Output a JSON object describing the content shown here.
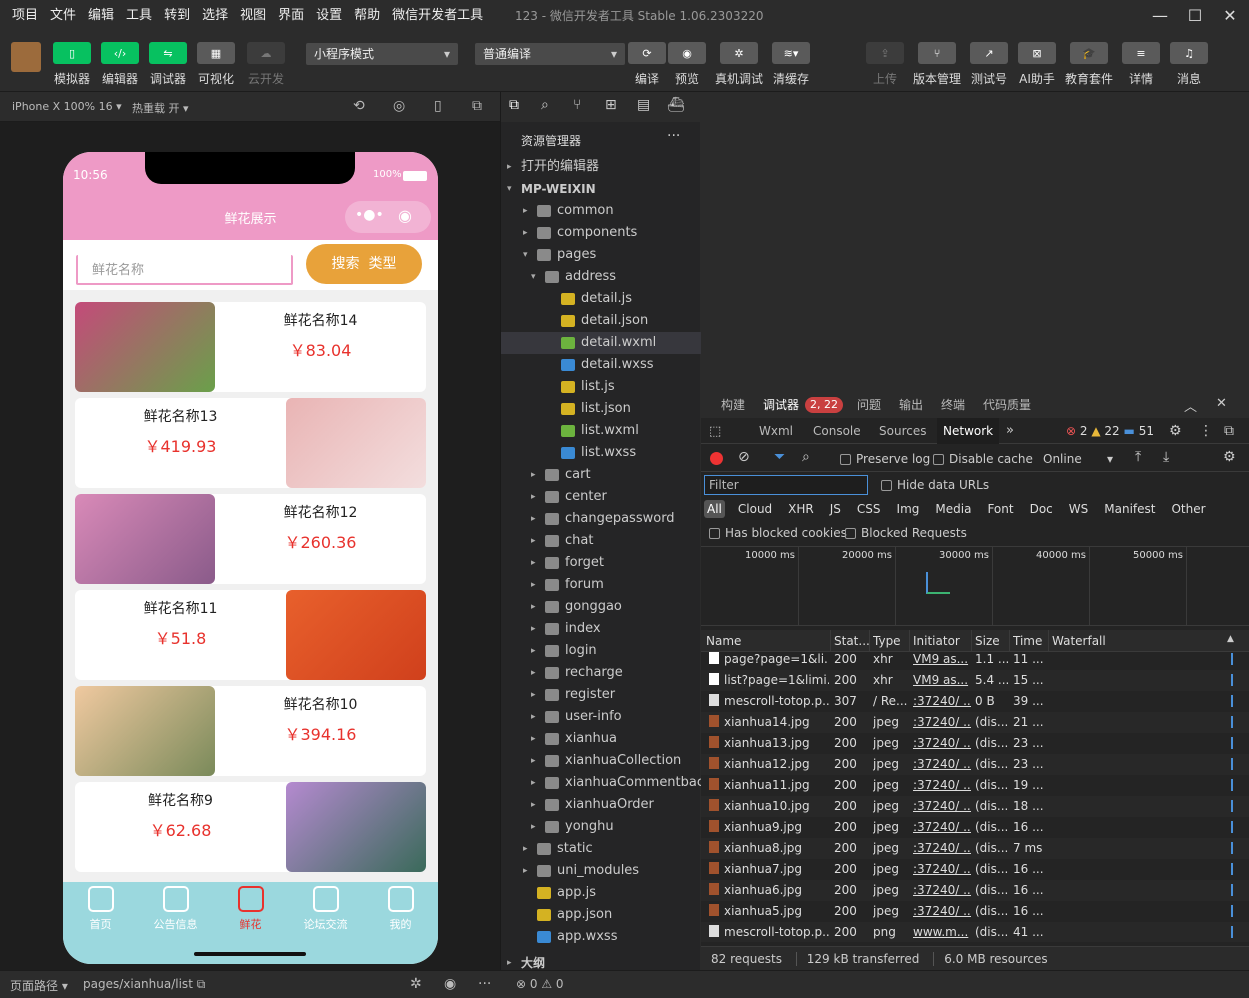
{
  "menubar": {
    "items": [
      "项目",
      "文件",
      "编辑",
      "工具",
      "转到",
      "选择",
      "视图",
      "界面",
      "设置",
      "帮助",
      "微信开发者工具"
    ],
    "title": "123 - 微信开发者工具 Stable 1.06.2303220"
  },
  "toolbar": {
    "left_buttons": [
      "模拟器",
      "编辑器",
      "调试器",
      "可视化",
      "云开发"
    ],
    "mode_select": "小程序模式",
    "compile_select": "普通编译",
    "mid_buttons": [
      "编译",
      "预览",
      "真机调试",
      "清缓存"
    ],
    "right_buttons": [
      "上传",
      "版本管理",
      "测试号",
      "AI助手",
      "教育套件",
      "详情",
      "消息"
    ]
  },
  "simbar": {
    "device": "iPhone X 100% 16",
    "hotreload": "热重载 开"
  },
  "phone": {
    "time": "10:56",
    "battery": "100%",
    "nav_title": "鲜花展示",
    "search_placeholder": "鲜花名称",
    "search_btn": "搜索",
    "type_btn": "类型",
    "cards": [
      {
        "name": "鲜花名称14",
        "price": "￥83.04"
      },
      {
        "name": "鲜花名称13",
        "price": "￥419.93"
      },
      {
        "name": "鲜花名称12",
        "price": "￥260.36"
      },
      {
        "name": "鲜花名称11",
        "price": "￥51.8"
      },
      {
        "name": "鲜花名称10",
        "price": "￥394.16"
      },
      {
        "name": "鲜花名称9",
        "price": "￥62.68"
      }
    ],
    "tabs": [
      "首页",
      "公告信息",
      "鲜花",
      "论坛交流",
      "我的"
    ]
  },
  "explorer": {
    "title": "资源管理器",
    "open_editors": "打开的编辑器",
    "root": "MP-WEIXIN",
    "items": [
      "common",
      "components",
      "pages",
      "address",
      "detail.js",
      "detail.json",
      "detail.wxml",
      "detail.wxss",
      "list.js",
      "list.json",
      "list.wxml",
      "list.wxss",
      "cart",
      "center",
      "changepassword",
      "chat",
      "forget",
      "forum",
      "gonggao",
      "index",
      "login",
      "recharge",
      "register",
      "user-info",
      "xianhua",
      "xianhuaCollection",
      "xianhuaCommentback",
      "xianhuaOrder",
      "yonghu",
      "static",
      "uni_modules",
      "app.js",
      "app.json",
      "app.wxss"
    ],
    "outline": "大纲"
  },
  "devtools": {
    "top_tabs": [
      "构建",
      "调试器",
      "问题",
      "输出",
      "终端",
      "代码质量"
    ],
    "badge": "2, 22",
    "panel_tabs": [
      "Wxml",
      "Console",
      "Sources",
      "Network"
    ],
    "counts": {
      "errors": "2",
      "warnings": "22",
      "info": "51"
    },
    "preserve_log": "Preserve log",
    "disable_cache": "Disable cache",
    "throttle": "Online",
    "filter_placeholder": "Filter",
    "hide_data_urls": "Hide data URLs",
    "type_filters": [
      "All",
      "Cloud",
      "XHR",
      "JS",
      "CSS",
      "Img",
      "Media",
      "Font",
      "Doc",
      "WS",
      "Manifest",
      "Other"
    ],
    "has_blocked": "Has blocked cookies",
    "blocked_requests": "Blocked Requests",
    "timeline": [
      "10000 ms",
      "20000 ms",
      "30000 ms",
      "40000 ms",
      "50000 ms"
    ],
    "columns": [
      "Name",
      "Stat...",
      "Type",
      "Initiator",
      "Size",
      "Time",
      "Waterfall"
    ],
    "rows": [
      [
        "page?page=1&li...",
        "200",
        "xhr",
        "VM9 as...",
        "1.1 ...",
        "11 ..."
      ],
      [
        "list?page=1&limi...",
        "200",
        "xhr",
        "VM9 as...",
        "5.4 ...",
        "15 ..."
      ],
      [
        "mescroll-totop.p...",
        "307",
        "/ Re...",
        ":37240/ ...",
        "0 B",
        "39 ..."
      ],
      [
        "xianhua14.jpg",
        "200",
        "jpeg",
        ":37240/ ...",
        "(dis...",
        "21 ..."
      ],
      [
        "xianhua13.jpg",
        "200",
        "jpeg",
        ":37240/ ...",
        "(dis...",
        "23 ..."
      ],
      [
        "xianhua12.jpg",
        "200",
        "jpeg",
        ":37240/ ...",
        "(dis...",
        "23 ..."
      ],
      [
        "xianhua11.jpg",
        "200",
        "jpeg",
        ":37240/ ...",
        "(dis...",
        "19 ..."
      ],
      [
        "xianhua10.jpg",
        "200",
        "jpeg",
        ":37240/ ...",
        "(dis...",
        "18 ..."
      ],
      [
        "xianhua9.jpg",
        "200",
        "jpeg",
        ":37240/ ...",
        "(dis...",
        "16 ..."
      ],
      [
        "xianhua8.jpg",
        "200",
        "jpeg",
        ":37240/ ...",
        "(dis...",
        "7 ms"
      ],
      [
        "xianhua7.jpg",
        "200",
        "jpeg",
        ":37240/ ...",
        "(dis...",
        "16 ..."
      ],
      [
        "xianhua6.jpg",
        "200",
        "jpeg",
        ":37240/ ...",
        "(dis...",
        "16 ..."
      ],
      [
        "xianhua5.jpg",
        "200",
        "jpeg",
        ":37240/ ...",
        "(dis...",
        "16 ..."
      ],
      [
        "mescroll-totop.p...",
        "200",
        "png",
        "www.m...",
        "(dis...",
        "41 ..."
      ]
    ],
    "summary": {
      "requests": "82 requests",
      "transferred": "129 kB transferred",
      "resources": "6.0 MB resources"
    }
  },
  "statusbar": {
    "path_label": "页面路径",
    "path": "pages/xianhua/list",
    "errors": "0",
    "warnings": "0"
  },
  "colors": {
    "accent_green": "#07c160",
    "nav_pink": "#ee9ac6",
    "search_orange": "#e8a23a",
    "price_red": "#e8322d",
    "tabbar": "#9bd8de"
  }
}
